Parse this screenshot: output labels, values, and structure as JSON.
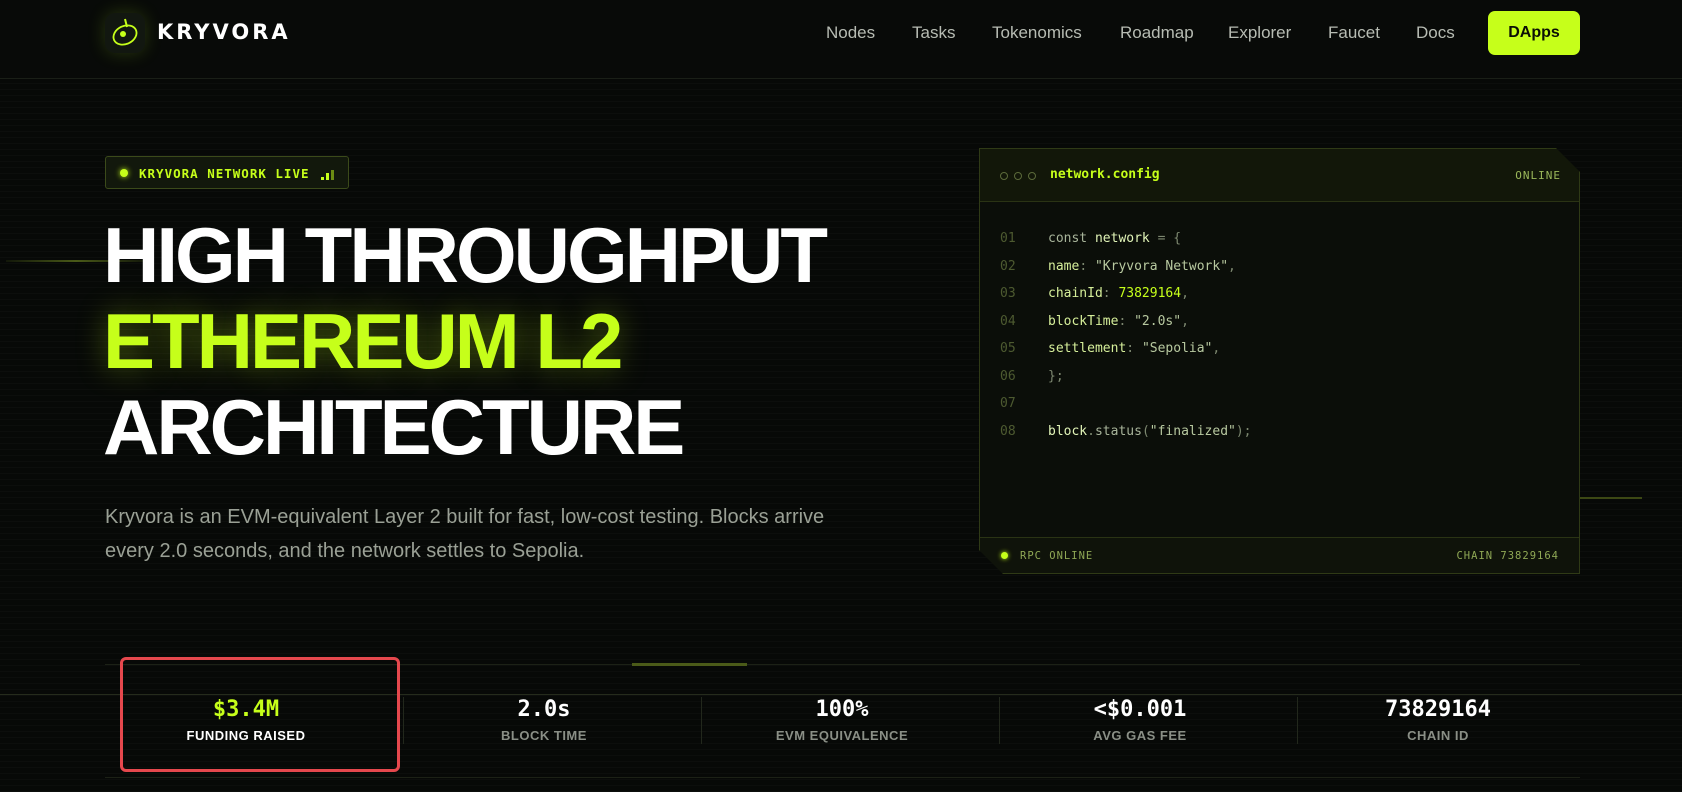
{
  "brand": {
    "name": "KRYVORA",
    "logo_icon": "kryvora-orbit-logo"
  },
  "nav": {
    "items": [
      "Nodes",
      "Tasks",
      "Tokenomics",
      "Roadmap",
      "Explorer",
      "Faucet",
      "Docs"
    ],
    "cta_label": "DApps"
  },
  "hero": {
    "badge": "KRYVORA NETWORK LIVE",
    "headline_line1": "HIGH THROUGHPUT",
    "headline_line2": "ETHEREUM L2",
    "headline_line3": "ARCHITECTURE",
    "description": "Kryvora is an EVM-equivalent Layer 2 built for fast, low-cost testing. Blocks arrive every 2.0 seconds, and the network settles to Sepolia."
  },
  "code_panel": {
    "title": "network.config",
    "status": "ONLINE",
    "line_numbers": [
      "01",
      "02",
      "03",
      "04",
      "05",
      "06",
      "07",
      "08"
    ],
    "footer_left": "RPC ONLINE",
    "footer_right": "CHAIN 73829164"
  },
  "stats": [
    {
      "value": "$3.4M",
      "label": "FUNDING RAISED"
    },
    {
      "value": "2.0s",
      "label": "BLOCK TIME"
    },
    {
      "value": "100%",
      "label": "EVM EQUIVALENCE"
    },
    {
      "value": "<$0.001",
      "label": "AVG GAS FEE"
    },
    {
      "value": "73829164",
      "label": "CHAIN ID"
    }
  ],
  "colors": {
    "accent": "#c6ff1a",
    "background": "#070907",
    "highlight_box": "#e5484d"
  }
}
